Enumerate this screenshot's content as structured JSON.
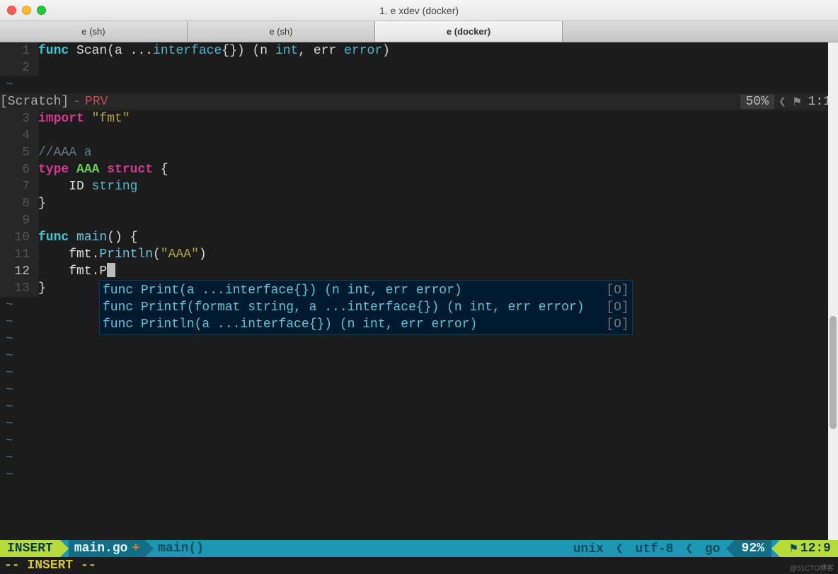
{
  "titlebar": {
    "title": "1. e xdev (docker)"
  },
  "tabs": [
    {
      "label": "e (sh)",
      "active": false
    },
    {
      "label": "e (sh)",
      "active": false
    },
    {
      "label": "e (docker)",
      "active": true
    }
  ],
  "top_pane": {
    "lines": [
      {
        "n": 1,
        "tokens": [
          {
            "t": "func ",
            "c": "kw-blue"
          },
          {
            "t": "Scan",
            "c": "punc"
          },
          {
            "t": "(a ...",
            "c": "punc"
          },
          {
            "t": "interface",
            "c": "id-cyan"
          },
          {
            "t": "{}) (n ",
            "c": "punc"
          },
          {
            "t": "int",
            "c": "id-cyan"
          },
          {
            "t": ", err ",
            "c": "punc"
          },
          {
            "t": "error",
            "c": "id-cyan"
          },
          {
            "t": ")",
            "c": "punc"
          }
        ]
      },
      {
        "n": 2,
        "tokens": []
      }
    ],
    "status": {
      "name": "[Scratch]",
      "prv": "PRV",
      "percent": "50%",
      "pos": "1:1"
    }
  },
  "bottom_pane": {
    "lines": [
      {
        "n": 3,
        "tokens": [
          {
            "t": "import ",
            "c": "kw-magenta"
          },
          {
            "t": "\"fmt\"",
            "c": "str"
          }
        ]
      },
      {
        "n": 4,
        "tokens": []
      },
      {
        "n": 5,
        "tokens": [
          {
            "t": "//AAA a",
            "c": "comment"
          }
        ]
      },
      {
        "n": 6,
        "tokens": [
          {
            "t": "type ",
            "c": "kw-magenta"
          },
          {
            "t": "AAA ",
            "c": "ty-green"
          },
          {
            "t": "struct",
            "c": "kw-magenta"
          },
          {
            "t": " {",
            "c": "punc"
          }
        ]
      },
      {
        "n": 7,
        "tokens": [
          {
            "t": "    ID ",
            "c": "punc"
          },
          {
            "t": "string",
            "c": "id-cyan"
          }
        ]
      },
      {
        "n": 8,
        "tokens": [
          {
            "t": "}",
            "c": "punc"
          }
        ]
      },
      {
        "n": 9,
        "tokens": []
      },
      {
        "n": 10,
        "tokens": [
          {
            "t": "func ",
            "c": "kw-blue"
          },
          {
            "t": "main",
            "c": "fn-name"
          },
          {
            "t": "() {",
            "c": "punc"
          }
        ]
      },
      {
        "n": 11,
        "tokens": [
          {
            "t": "    fmt.",
            "c": "punc"
          },
          {
            "t": "Println",
            "c": "fn-name"
          },
          {
            "t": "(",
            "c": "punc"
          },
          {
            "t": "\"AAA\"",
            "c": "str"
          },
          {
            "t": ")",
            "c": "punc"
          }
        ]
      },
      {
        "n": 12,
        "tokens": [
          {
            "t": "    fmt.P",
            "c": "punc"
          }
        ],
        "cursor": true,
        "current": true
      },
      {
        "n": 13,
        "tokens": [
          {
            "t": "}",
            "c": "punc"
          }
        ]
      }
    ]
  },
  "completion": {
    "items": [
      {
        "sig": "func Print(a ...interface{}) (n int, err error)",
        "src": "[O]"
      },
      {
        "sig": "func Printf(format string, a ...interface{}) (n int, err error)",
        "src": "[O]"
      },
      {
        "sig": "func Println(a ...interface{}) (n int, err error)",
        "src": "[O]"
      }
    ]
  },
  "statusbar": {
    "mode": "INSERT",
    "file": "main.go",
    "modified": "+",
    "func": "main()",
    "fileformat": "unix",
    "encoding": "utf-8",
    "filetype": "go",
    "percent": "92%",
    "pos": "12:9"
  },
  "cmdline": "-- INSERT --",
  "watermark": "@51CTO博客"
}
